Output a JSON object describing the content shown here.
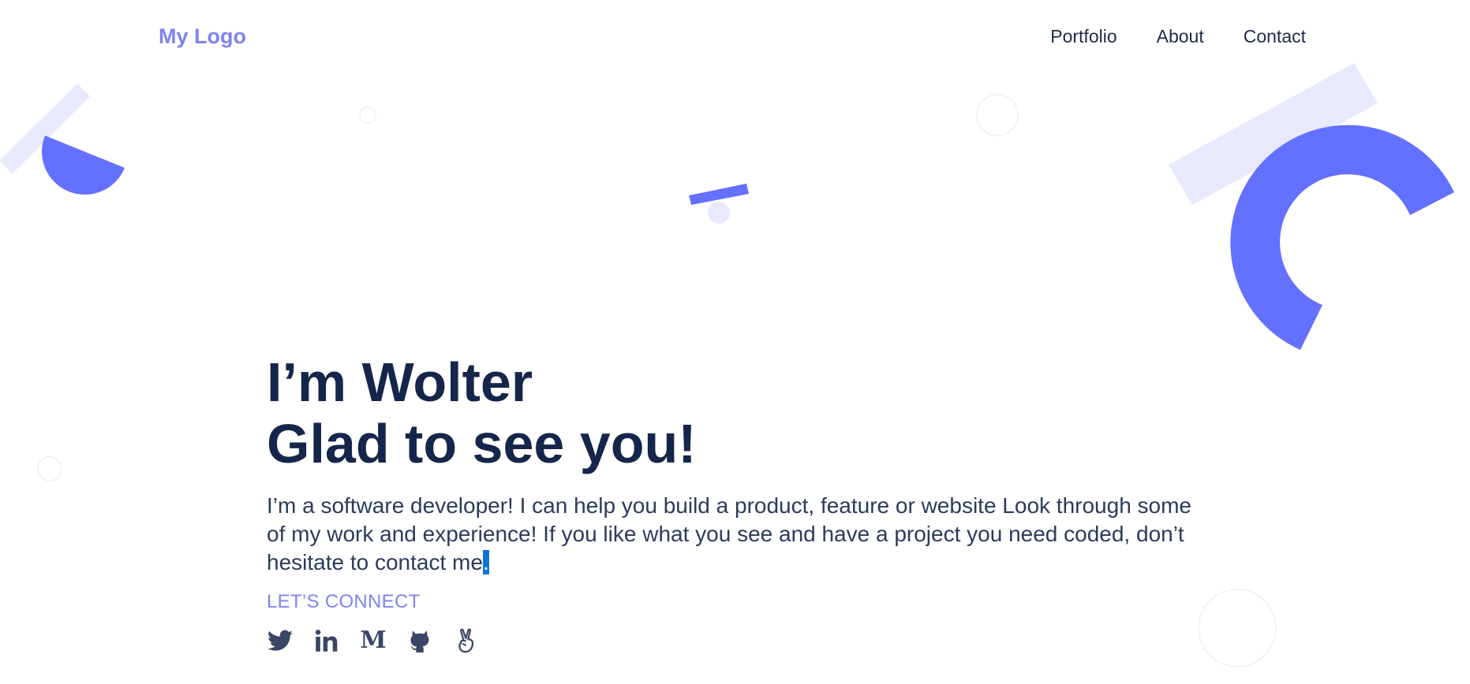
{
  "header": {
    "logo": "My Logo",
    "nav": [
      {
        "label": "Portfolio"
      },
      {
        "label": "About"
      },
      {
        "label": "Contact"
      }
    ]
  },
  "hero": {
    "title_line1": "I’m Wolter",
    "title_line2": "Glad to see you!",
    "description": "I’m a software developer! I can help you build a product, feature or website Look through some of my work and experience! If you like what you see and have a project you need coded, don’t hesitate to contact me",
    "description_end": ".",
    "connect_label": "LET’S CONNECT"
  },
  "socials": [
    {
      "icon": "twitter-icon"
    },
    {
      "icon": "linkedin-icon",
      "text": "in"
    },
    {
      "icon": "medium-icon",
      "text": "M"
    },
    {
      "icon": "github-icon"
    },
    {
      "icon": "peace-hand-icon"
    }
  ],
  "colors": {
    "accent": "#6470ff",
    "accent_light": "#e8e9fd",
    "logo": "#7d84f2",
    "heading": "#16254a",
    "text": "#2c3a5c",
    "selection": "#1173d4"
  }
}
